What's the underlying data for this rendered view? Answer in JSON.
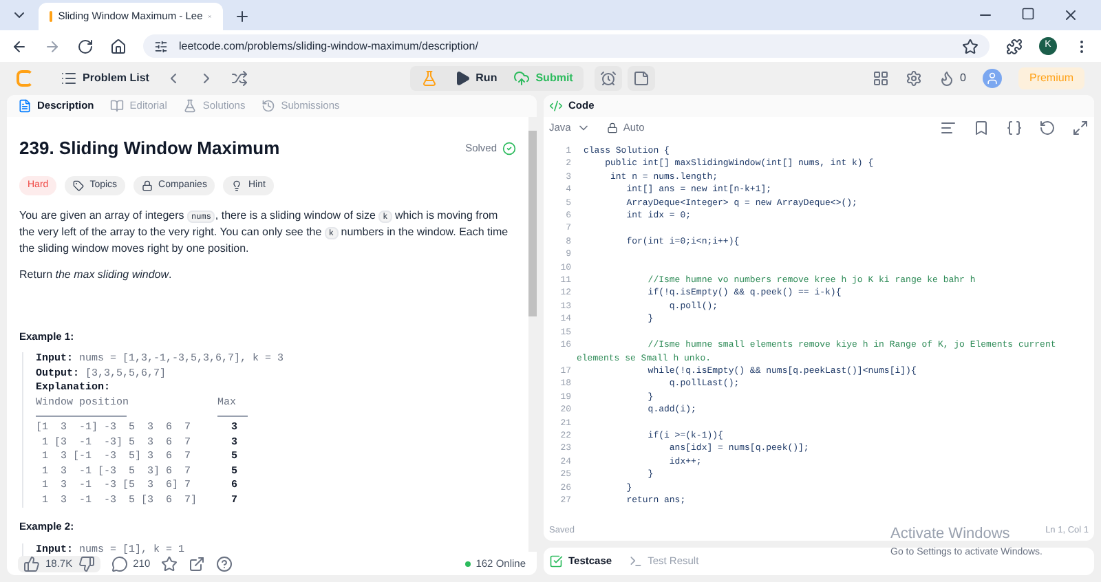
{
  "browser": {
    "tab_title": "Sliding Window Maximum - Lee",
    "url": "leetcode.com/problems/sliding-window-maximum/description/",
    "profile_initial": "K"
  },
  "toolbar": {
    "problem_list": "Problem List",
    "run": "Run",
    "submit": "Submit",
    "streak": "0",
    "premium": "Premium"
  },
  "left_tabs": [
    {
      "label": "Description",
      "selected": true
    },
    {
      "label": "Editorial",
      "selected": false
    },
    {
      "label": "Solutions",
      "selected": false
    },
    {
      "label": "Submissions",
      "selected": false
    }
  ],
  "problem": {
    "title": "239. Sliding Window Maximum",
    "status": "Solved",
    "difficulty": "Hard",
    "tags": [
      "Topics",
      "Companies",
      "Hint"
    ],
    "paragraph": [
      "You are given an array of integers ",
      "nums",
      ", there is a sliding window of size ",
      "k",
      " which is moving from the very left of the array to the very right. You can only see the ",
      "k",
      " numbers in the window. Each time the sliding window moves right by one position."
    ],
    "return_text": "Return *the max sliding window*."
  },
  "examples": [
    {
      "title": "Example 1:",
      "input_label": "Input:",
      "input": "nums = [1,3,-1,-3,5,3,6,7], k = 3",
      "output_label": "Output:",
      "output": "[3,3,5,5,6,7]",
      "explanation_label": "Explanation:",
      "col_window": "Window position",
      "col_max": "Max",
      "rows": [
        {
          "window": "[1  3  -1] -3  5  3  6  7",
          "max": "3"
        },
        {
          "window": " 1 [3  -1  -3] 5  3  6  7",
          "max": "3"
        },
        {
          "window": " 1  3 [-1  -3  5] 3  6  7",
          "max": "5"
        },
        {
          "window": " 1  3  -1 [-3  5  3] 6  7",
          "max": "5"
        },
        {
          "window": " 1  3  -1  -3 [5  3  6] 7",
          "max": "6"
        },
        {
          "window": " 1  3  -1  -3  5 [3  6  7]",
          "max": "7"
        }
      ]
    },
    {
      "title": "Example 2:",
      "input_label": "Input:",
      "input": "nums = [1], k = 1"
    }
  ],
  "footer": {
    "likes": "18.7K",
    "comments": "210",
    "online": "162 Online"
  },
  "code_panel": {
    "title": "Code",
    "language": "Java",
    "mode": "Auto",
    "saved": "Saved",
    "cursor": "Ln 1, Col 1",
    "lines": [
      {
        "n": "1",
        "kind": "code",
        "text": "class Solution {"
      },
      {
        "n": "2",
        "kind": "code",
        "text": "    public int[] maxSlidingWindow(int[] nums, int k) {"
      },
      {
        "n": "3",
        "kind": "code",
        "text": "     int n = nums.length;"
      },
      {
        "n": "4",
        "kind": "code",
        "text": "        int[] ans = new int[n-k+1];"
      },
      {
        "n": "5",
        "kind": "code",
        "text": "        ArrayDeque<Integer> q = new ArrayDeque<>();"
      },
      {
        "n": "6",
        "kind": "code",
        "text": "        int idx = 0;"
      },
      {
        "n": "7"
      },
      {
        "n": "8",
        "kind": "code",
        "text": "        for(int i=0;i<n;i++){"
      },
      {
        "n": "9"
      },
      {
        "n": "10"
      },
      {
        "n": "11",
        "kind": "comment",
        "text": "            //Isme humne vo numbers remove kree h jo K ki range ke bahr h"
      },
      {
        "n": "12",
        "kind": "code",
        "text": "            if(!q.isEmpty() && q.peek() == i-k){"
      },
      {
        "n": "13",
        "kind": "code",
        "text": "                q.poll();"
      },
      {
        "n": "14",
        "kind": "code",
        "text": "            }"
      },
      {
        "n": "15"
      },
      {
        "n": "16",
        "kind": "comment",
        "text": "            //Isme humne small elements remove kiye h in Range of K, jo Elements current",
        "continuation": "elements se Small h unko."
      },
      {
        "n": "17",
        "kind": "code",
        "text": "            while(!q.isEmpty() && nums[q.peekLast()]<nums[i]){"
      },
      {
        "n": "18",
        "kind": "code",
        "text": "                q.pollLast();"
      },
      {
        "n": "19",
        "kind": "code",
        "text": "            }"
      },
      {
        "n": "20",
        "kind": "code",
        "text": "            q.add(i);"
      },
      {
        "n": "21"
      },
      {
        "n": "22",
        "kind": "code",
        "text": "            if(i >=(k-1)){"
      },
      {
        "n": "23",
        "kind": "code",
        "text": "                ans[idx] = nums[q.peek()];"
      },
      {
        "n": "24",
        "kind": "code",
        "text": "                idx++;"
      },
      {
        "n": "25",
        "kind": "code",
        "text": "            }"
      },
      {
        "n": "26",
        "kind": "code",
        "text": "        }"
      },
      {
        "n": "27",
        "kind": "code",
        "text": "        return ans;"
      }
    ]
  },
  "bottom_tabs": [
    {
      "label": "Testcase",
      "selected": true
    },
    {
      "label": "Test Result",
      "selected": false
    }
  ],
  "os_notice": {
    "title": "Activate Windows",
    "subtitle": "Go to Settings to activate Windows."
  }
}
